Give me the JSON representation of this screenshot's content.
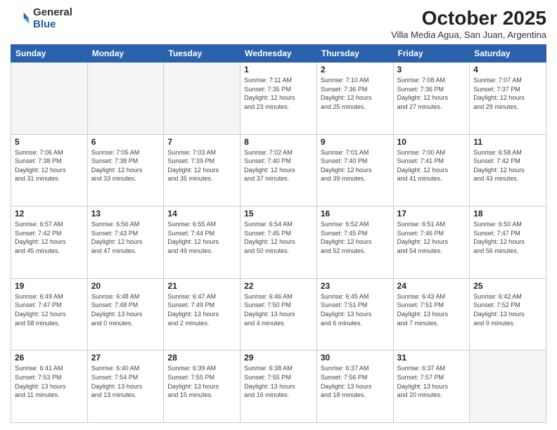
{
  "header": {
    "logo_general": "General",
    "logo_blue": "Blue",
    "title": "October 2025",
    "subtitle": "Villa Media Agua, San Juan, Argentina"
  },
  "weekdays": [
    "Sunday",
    "Monday",
    "Tuesday",
    "Wednesday",
    "Thursday",
    "Friday",
    "Saturday"
  ],
  "weeks": [
    [
      {
        "day": "",
        "info": ""
      },
      {
        "day": "",
        "info": ""
      },
      {
        "day": "",
        "info": ""
      },
      {
        "day": "1",
        "info": "Sunrise: 7:11 AM\nSunset: 7:35 PM\nDaylight: 12 hours\nand 23 minutes."
      },
      {
        "day": "2",
        "info": "Sunrise: 7:10 AM\nSunset: 7:36 PM\nDaylight: 12 hours\nand 25 minutes."
      },
      {
        "day": "3",
        "info": "Sunrise: 7:08 AM\nSunset: 7:36 PM\nDaylight: 12 hours\nand 27 minutes."
      },
      {
        "day": "4",
        "info": "Sunrise: 7:07 AM\nSunset: 7:37 PM\nDaylight: 12 hours\nand 29 minutes."
      }
    ],
    [
      {
        "day": "5",
        "info": "Sunrise: 7:06 AM\nSunset: 7:38 PM\nDaylight: 12 hours\nand 31 minutes."
      },
      {
        "day": "6",
        "info": "Sunrise: 7:05 AM\nSunset: 7:38 PM\nDaylight: 12 hours\nand 33 minutes."
      },
      {
        "day": "7",
        "info": "Sunrise: 7:03 AM\nSunset: 7:39 PM\nDaylight: 12 hours\nand 35 minutes."
      },
      {
        "day": "8",
        "info": "Sunrise: 7:02 AM\nSunset: 7:40 PM\nDaylight: 12 hours\nand 37 minutes."
      },
      {
        "day": "9",
        "info": "Sunrise: 7:01 AM\nSunset: 7:40 PM\nDaylight: 12 hours\nand 39 minutes."
      },
      {
        "day": "10",
        "info": "Sunrise: 7:00 AM\nSunset: 7:41 PM\nDaylight: 12 hours\nand 41 minutes."
      },
      {
        "day": "11",
        "info": "Sunrise: 6:58 AM\nSunset: 7:42 PM\nDaylight: 12 hours\nand 43 minutes."
      }
    ],
    [
      {
        "day": "12",
        "info": "Sunrise: 6:57 AM\nSunset: 7:42 PM\nDaylight: 12 hours\nand 45 minutes."
      },
      {
        "day": "13",
        "info": "Sunrise: 6:56 AM\nSunset: 7:43 PM\nDaylight: 12 hours\nand 47 minutes."
      },
      {
        "day": "14",
        "info": "Sunrise: 6:55 AM\nSunset: 7:44 PM\nDaylight: 12 hours\nand 49 minutes."
      },
      {
        "day": "15",
        "info": "Sunrise: 6:54 AM\nSunset: 7:45 PM\nDaylight: 12 hours\nand 50 minutes."
      },
      {
        "day": "16",
        "info": "Sunrise: 6:52 AM\nSunset: 7:45 PM\nDaylight: 12 hours\nand 52 minutes."
      },
      {
        "day": "17",
        "info": "Sunrise: 6:51 AM\nSunset: 7:46 PM\nDaylight: 12 hours\nand 54 minutes."
      },
      {
        "day": "18",
        "info": "Sunrise: 6:50 AM\nSunset: 7:47 PM\nDaylight: 12 hours\nand 56 minutes."
      }
    ],
    [
      {
        "day": "19",
        "info": "Sunrise: 6:49 AM\nSunset: 7:47 PM\nDaylight: 12 hours\nand 58 minutes."
      },
      {
        "day": "20",
        "info": "Sunrise: 6:48 AM\nSunset: 7:48 PM\nDaylight: 13 hours\nand 0 minutes."
      },
      {
        "day": "21",
        "info": "Sunrise: 6:47 AM\nSunset: 7:49 PM\nDaylight: 13 hours\nand 2 minutes."
      },
      {
        "day": "22",
        "info": "Sunrise: 6:46 AM\nSunset: 7:50 PM\nDaylight: 13 hours\nand 4 minutes."
      },
      {
        "day": "23",
        "info": "Sunrise: 6:45 AM\nSunset: 7:51 PM\nDaylight: 13 hours\nand 6 minutes."
      },
      {
        "day": "24",
        "info": "Sunrise: 6:43 AM\nSunset: 7:51 PM\nDaylight: 13 hours\nand 7 minutes."
      },
      {
        "day": "25",
        "info": "Sunrise: 6:42 AM\nSunset: 7:52 PM\nDaylight: 13 hours\nand 9 minutes."
      }
    ],
    [
      {
        "day": "26",
        "info": "Sunrise: 6:41 AM\nSunset: 7:53 PM\nDaylight: 13 hours\nand 11 minutes."
      },
      {
        "day": "27",
        "info": "Sunrise: 6:40 AM\nSunset: 7:54 PM\nDaylight: 13 hours\nand 13 minutes."
      },
      {
        "day": "28",
        "info": "Sunrise: 6:39 AM\nSunset: 7:55 PM\nDaylight: 13 hours\nand 15 minutes."
      },
      {
        "day": "29",
        "info": "Sunrise: 6:38 AM\nSunset: 7:55 PM\nDaylight: 13 hours\nand 16 minutes."
      },
      {
        "day": "30",
        "info": "Sunrise: 6:37 AM\nSunset: 7:56 PM\nDaylight: 13 hours\nand 18 minutes."
      },
      {
        "day": "31",
        "info": "Sunrise: 6:37 AM\nSunset: 7:57 PM\nDaylight: 13 hours\nand 20 minutes."
      },
      {
        "day": "",
        "info": ""
      }
    ]
  ]
}
